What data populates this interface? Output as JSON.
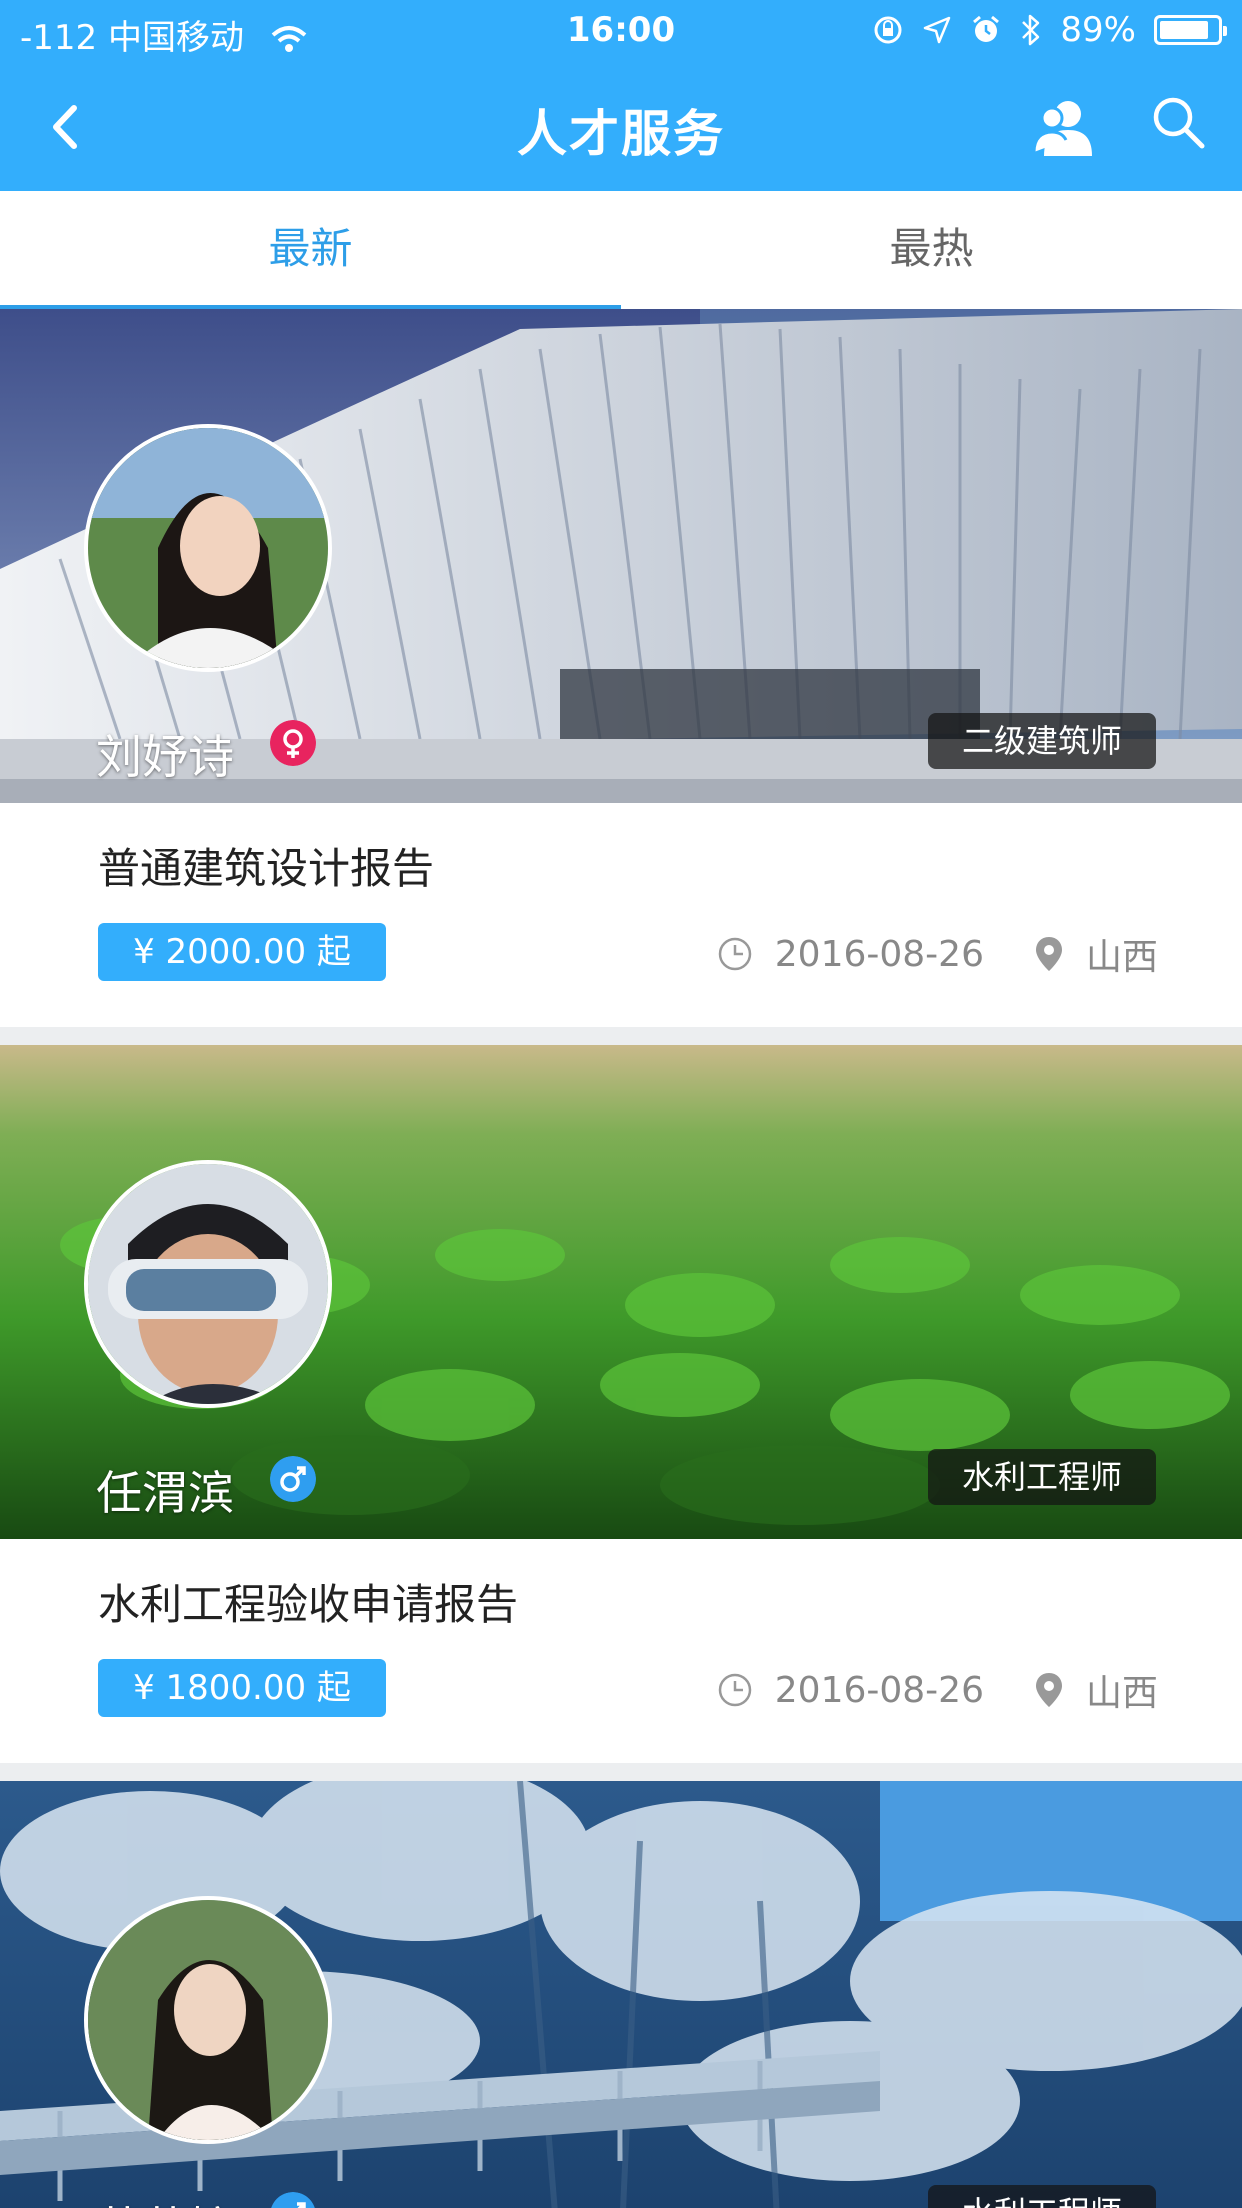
{
  "status_bar": {
    "carrier": "-112 中国移动",
    "time": "16:00",
    "battery": "89%"
  },
  "nav": {
    "title": "人才服务"
  },
  "tabs": [
    {
      "label": "最新",
      "active": true
    },
    {
      "label": "最热",
      "active": false
    }
  ],
  "cards": [
    {
      "name": "刘妤诗",
      "gender": "female",
      "role": "二级建筑师",
      "title": "普通建筑设计报告",
      "price": "¥ 2000.00 起",
      "date": "2016-08-26",
      "location": "山西"
    },
    {
      "name": "任渭滨",
      "gender": "male",
      "role": "水利工程师",
      "title": "水利工程验收申请报告",
      "price": "¥ 1800.00 起",
      "date": "2016-08-26",
      "location": "山西"
    },
    {
      "name": "萧若婷",
      "gender": "male",
      "role": "水利工程师"
    }
  ],
  "colors": {
    "primary": "#33aefc",
    "tab_active": "#2d9ee8",
    "female": "#e8245f",
    "male": "#2f9ef0"
  }
}
